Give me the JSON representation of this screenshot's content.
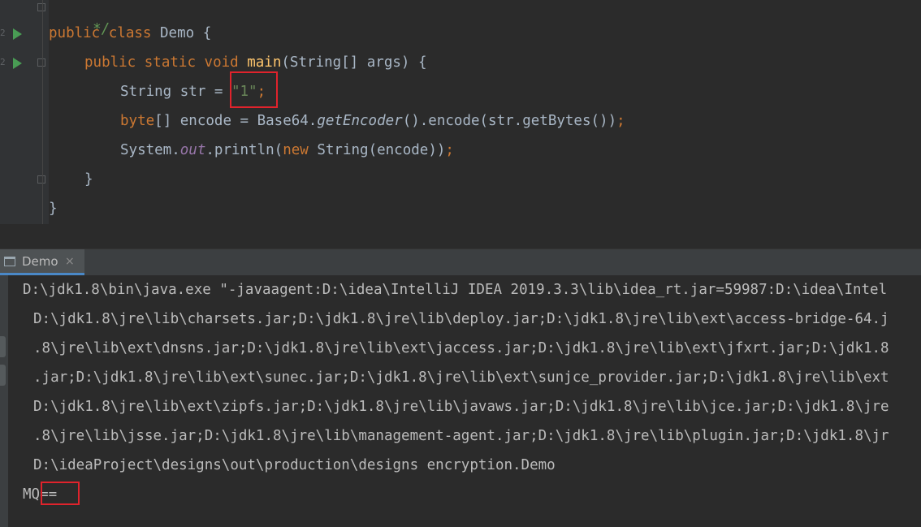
{
  "editor": {
    "lines": {
      "comment": "*/",
      "class_decl": {
        "kw1": "public",
        "kw2": "class",
        "name": "Demo",
        "brace": " {"
      },
      "main_decl": {
        "kw1": "public",
        "kw2": "static",
        "kw3": "void",
        "name": "main",
        "params": "(String[] args) {"
      },
      "str_decl": {
        "prefix": "String str = ",
        "value": "\"1\"",
        "semi": ";"
      },
      "encode_decl": {
        "kw": "byte",
        "mid": "[] encode = Base64.",
        "call": "getEncoder",
        "rest": "().encode(str.getBytes())",
        "semi": ";"
      },
      "print_stmt": {
        "prefix": "System.",
        "field": "out",
        "mid": ".println(",
        "kw": "new",
        "rest": " String(encode))",
        "semi": ";"
      },
      "close_method": "}",
      "close_class": "}"
    },
    "line_numbers": [
      "2",
      "2"
    ]
  },
  "run_panel": {
    "tab_label": "Demo",
    "close_glyph": "×",
    "output": [
      "D:\\jdk1.8\\bin\\java.exe \"-javaagent:D:\\idea\\IntelliJ IDEA 2019.3.3\\lib\\idea_rt.jar=59987:D:\\idea\\Intel",
      "D:\\jdk1.8\\jre\\lib\\charsets.jar;D:\\jdk1.8\\jre\\lib\\deploy.jar;D:\\jdk1.8\\jre\\lib\\ext\\access-bridge-64.j",
      ".8\\jre\\lib\\ext\\dnsns.jar;D:\\jdk1.8\\jre\\lib\\ext\\jaccess.jar;D:\\jdk1.8\\jre\\lib\\ext\\jfxrt.jar;D:\\jdk1.8",
      ".jar;D:\\jdk1.8\\jre\\lib\\ext\\sunec.jar;D:\\jdk1.8\\jre\\lib\\ext\\sunjce_provider.jar;D:\\jdk1.8\\jre\\lib\\ext",
      "D:\\jdk1.8\\jre\\lib\\ext\\zipfs.jar;D:\\jdk1.8\\jre\\lib\\javaws.jar;D:\\jdk1.8\\jre\\lib\\jce.jar;D:\\jdk1.8\\jre",
      ".8\\jre\\lib\\jsse.jar;D:\\jdk1.8\\jre\\lib\\management-agent.jar;D:\\jdk1.8\\jre\\lib\\plugin.jar;D:\\jdk1.8\\jr",
      "D:\\ideaProject\\designs\\out\\production\\designs encryption.Demo",
      "MQ=="
    ]
  },
  "colors": {
    "keyword": "#cc7832",
    "string": "#6a8759",
    "function": "#ffc66d",
    "highlight": "#e0232c",
    "run": "#499c54"
  }
}
